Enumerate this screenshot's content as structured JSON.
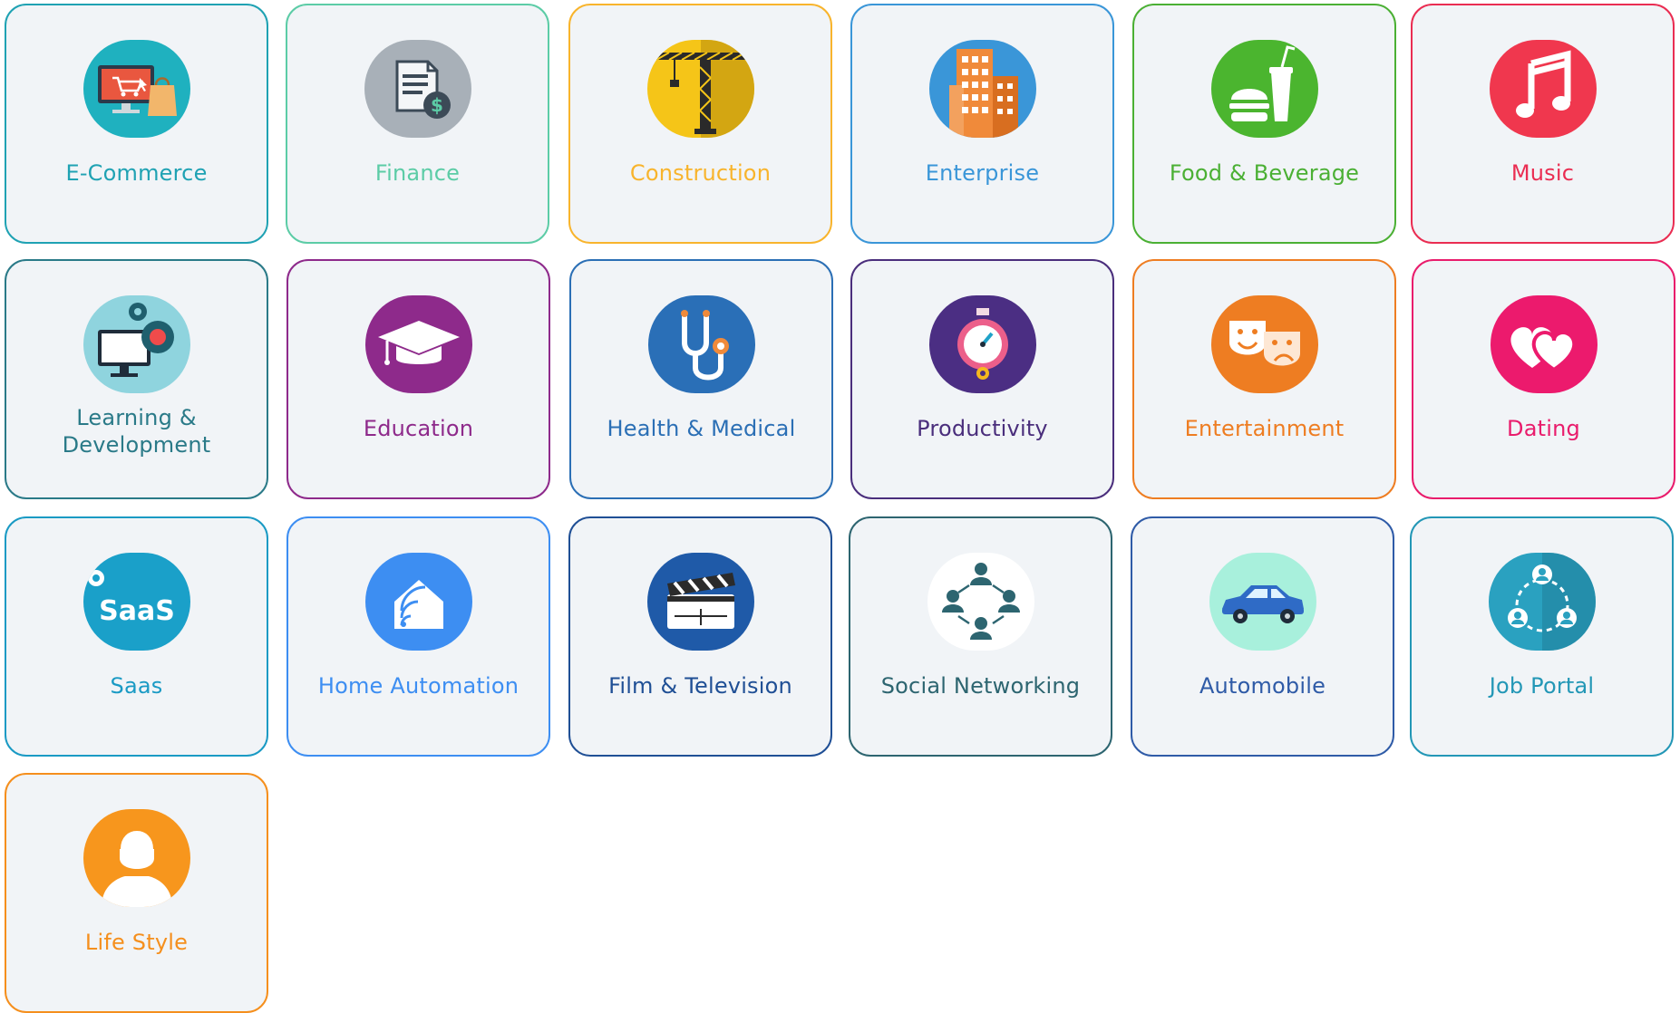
{
  "categories": [
    {
      "label": "E-Commerce",
      "icon": "shopping-cart-icon",
      "color": "#1fa2b3"
    },
    {
      "label": "Finance",
      "icon": "invoice-dollar-icon",
      "color": "#5ccca6"
    },
    {
      "label": "Construction",
      "icon": "crane-icon",
      "color": "#f8b42c"
    },
    {
      "label": "Enterprise",
      "icon": "buildings-icon",
      "color": "#3a96d8"
    },
    {
      "label": "Food & Beverage",
      "icon": "burger-drink-icon",
      "color": "#4bb034"
    },
    {
      "label": "Music",
      "icon": "music-note-icon",
      "color": "#ea2d52"
    },
    {
      "label": "Learning & Development",
      "label_line1": "Learning &",
      "label_line2": "Development",
      "icon": "computer-gear-icon",
      "color": "#2a7a88"
    },
    {
      "label": "Education",
      "icon": "graduation-cap-icon",
      "color": "#8e2a8b"
    },
    {
      "label": "Health & Medical",
      "icon": "stethoscope-icon",
      "color": "#2b6fb5"
    },
    {
      "label": "Productivity",
      "icon": "stopwatch-icon",
      "color": "#4a2e7c"
    },
    {
      "label": "Entertainment",
      "icon": "theater-masks-icon",
      "color": "#ee7d22"
    },
    {
      "label": "Dating",
      "icon": "hearts-icon",
      "color": "#e91c6c"
    },
    {
      "label": "Saas",
      "icon": "saas-icon",
      "color": "#1a9ac4"
    },
    {
      "label": "Home Automation",
      "icon": "smart-home-icon",
      "color": "#3d8ef2"
    },
    {
      "label": "Film & Television",
      "icon": "clapperboard-icon",
      "color": "#1f4f95"
    },
    {
      "label": "Social Networking",
      "icon": "network-people-icon",
      "color": "#2d6570"
    },
    {
      "label": "Automobile",
      "icon": "car-icon",
      "color": "#2f5ba7"
    },
    {
      "label": "Job Portal",
      "icon": "job-people-icon",
      "color": "#2397b6"
    },
    {
      "label": "Life Style",
      "icon": "person-avatar-icon",
      "color": "#f58f1d"
    }
  ]
}
